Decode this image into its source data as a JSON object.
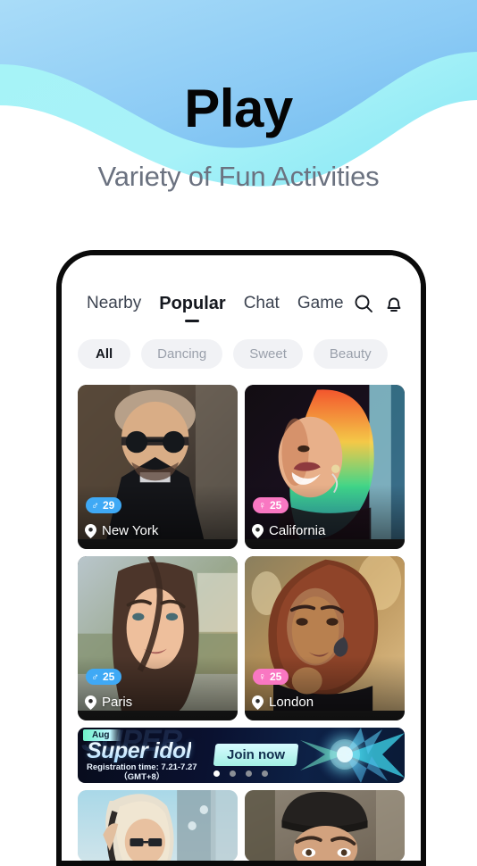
{
  "hero": {
    "title": "Play",
    "subtitle": "Variety of Fun Activities",
    "wave_top_color": "#7cc2f2",
    "wave_mid_color": "#9ff2f8"
  },
  "app": {
    "tabs": [
      {
        "label": "Nearby",
        "active": false
      },
      {
        "label": "Popular",
        "active": true
      },
      {
        "label": "Chat",
        "active": false
      },
      {
        "label": "Game",
        "active": false
      }
    ],
    "actions": [
      {
        "name": "search-icon",
        "label": "Search"
      },
      {
        "name": "bell-icon",
        "label": "Notifications"
      }
    ],
    "chips": [
      {
        "label": "All",
        "active": true
      },
      {
        "label": "Dancing",
        "active": false
      },
      {
        "label": "Sweet",
        "active": false
      },
      {
        "label": "Beauty",
        "active": false
      }
    ],
    "cards": [
      {
        "gender": "male",
        "gender_symbol": "♂",
        "age": "29",
        "location": "New York"
      },
      {
        "gender": "female",
        "gender_symbol": "♀",
        "age": "25",
        "location": "California"
      },
      {
        "gender": "male",
        "gender_symbol": "♂",
        "age": "25",
        "location": "Paris"
      },
      {
        "gender": "female",
        "gender_symbol": "♀",
        "age": "25",
        "location": "London"
      }
    ],
    "banner": {
      "month_tag": "Aug",
      "ghost_text": "SUPER",
      "title": "Super idol",
      "registration": "Registration time: 7.21-7.27",
      "timezone": "（GMT+8）",
      "cta": "Join now",
      "dots": 4,
      "active_dot": 0
    },
    "colors": {
      "male_badge": "#3fa9f5",
      "female_badge": "#f977c2",
      "chip_bg": "#f1f2f5",
      "text_dark": "#15181f",
      "text_muted": "#9aa0ab"
    }
  }
}
